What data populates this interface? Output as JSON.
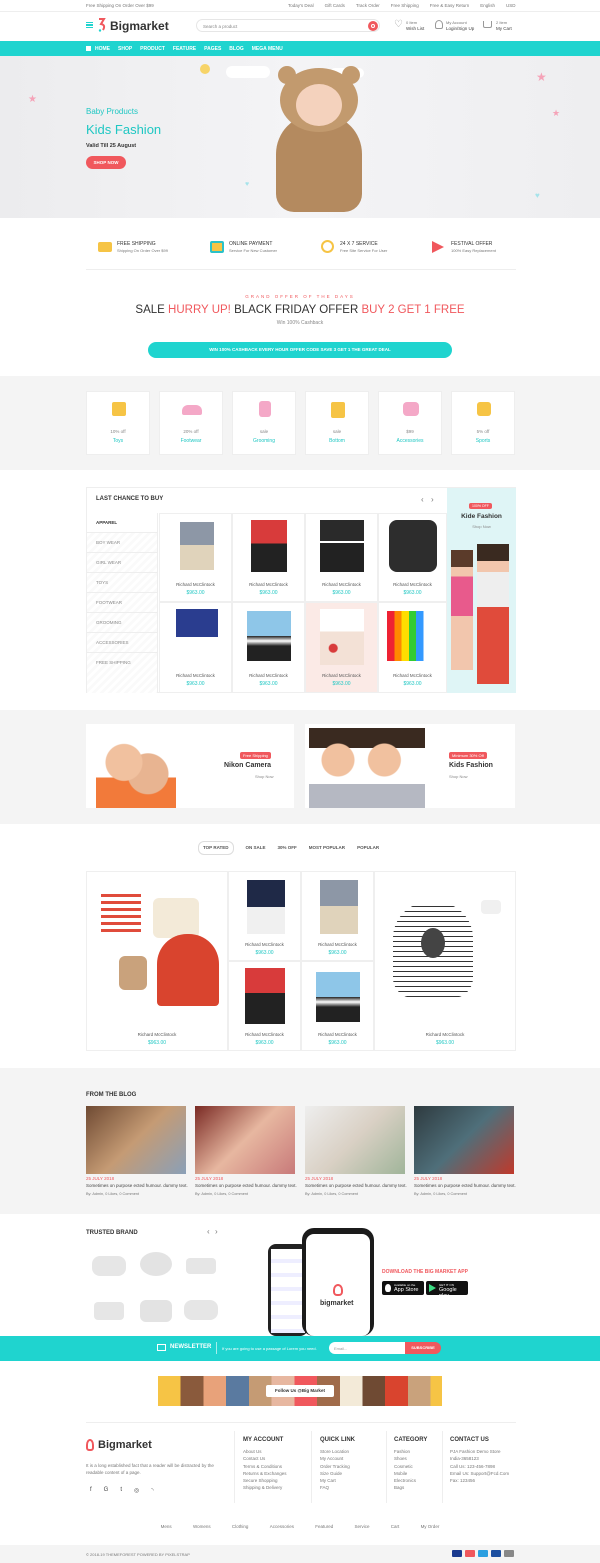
{
  "topbar": {
    "promo": "Free Shipping On Order Over $99",
    "links": [
      "Today's Deal",
      "Gift Cards",
      "Track Order",
      "Free Shipping",
      "Free & Easy Return",
      "English",
      "USD"
    ]
  },
  "header": {
    "logo": "Bigmarket",
    "search_placeholder": "Search a product",
    "wishlist_top": "0 Item",
    "wishlist": "Wish List",
    "account_top": "My Account",
    "account": "Login/Sign Up",
    "cart_top": "2 Item",
    "cart": "My Cart"
  },
  "nav": [
    "HOME",
    "SHOP",
    "PRODUCT",
    "FEATURE",
    "PAGES",
    "BLOG",
    "MEGA MENU"
  ],
  "hero": {
    "subtitle": "Baby Products",
    "title": "Kids Fashion",
    "valid": "Valid Till 25 August",
    "cta": "SHOP NOW"
  },
  "services": [
    {
      "title": "FREE SHIPPING",
      "sub": "Shipping On Order Over $99",
      "icon": "truck-icon"
    },
    {
      "title": "ONLINE PAYMENT",
      "sub": "Service For New Customer",
      "icon": "card-icon"
    },
    {
      "title": "24 X 7 SERVICE",
      "sub": "Free Site Service For User",
      "icon": "clock-icon"
    },
    {
      "title": "FESTIVAL OFFER",
      "sub": "100% Easy Replacement",
      "icon": "megaphone-icon"
    }
  ],
  "offer": {
    "kicker": "GRAND OFFER OF THE DAYS",
    "p1": "SALE ",
    "p2": "HURRY UP!",
    "p3": " BLACK FRIDAY OFFER ",
    "p4": "BUY 2 GET 1 FREE",
    "sub": "Win 100% Cashback",
    "bar": "WIN 100% CASHBACK EVERY HOUR OFFER CODE SAVE 3 GET 1 THE GREAT DEAL"
  },
  "categories": [
    {
      "off": "10% off",
      "name": "Toys"
    },
    {
      "off": "20% off",
      "name": "Footwear"
    },
    {
      "off": "sale",
      "name": "Grooming"
    },
    {
      "off": "sale",
      "name": "Bottom"
    },
    {
      "off": "$99",
      "name": "Accessories"
    },
    {
      "off": "5% off",
      "name": "Sports"
    }
  ],
  "last_chance": {
    "title": "LAST CHANCE TO BUY",
    "menu": [
      "APPAREL",
      "BOY WEAR",
      "GIRL WEAR",
      "TOYS",
      "FOOTWEAR",
      "GROOMING",
      "ACCESSORIES",
      "FREE SHIPPING"
    ],
    "product_name": "Richard McClintock",
    "product_price": "$963.00",
    "side_badge": "100% OFF",
    "side_title": "Kide Fashion",
    "side_link": "Shop Now"
  },
  "promos": [
    {
      "badge": "Free Shipping",
      "title": "Nikon Camera",
      "link": "Shop Now"
    },
    {
      "badge": "Minimum 30% Off",
      "title": "Kids Fashion",
      "link": "Shop Now"
    }
  ],
  "tabs": [
    "TOP RATED",
    "ON SALE",
    "30% OFF",
    "MOST POPULAR",
    "POPULAR"
  ],
  "grid_product": {
    "name": "Richard McClintock",
    "price": "$963.00"
  },
  "blog": {
    "title": "FROM THE BLOG",
    "date": "25 JULY 2018",
    "excerpt": "Sometimes on purpose ected humour. dummy text.",
    "meta": "By: Admin, 0 Likes, 0 Comment"
  },
  "brands": {
    "title": "TRUSTED BRAND"
  },
  "app": {
    "title": "DOWNLOAD THE BIG MARKET APP",
    "store1_top": "Available on the",
    "store1": "App Store",
    "store2_top": "GET IT ON",
    "store2": "Google play",
    "phone_logo": "bigmarket"
  },
  "newsletter": {
    "title": "NEWSLETTER",
    "text": "If you are going to use a passage of Lorem you need.",
    "placeholder": "Email...",
    "button": "SUBSCRIBE"
  },
  "instagram": {
    "label": "Follow Us @Big Market"
  },
  "footer": {
    "logo": "Bigmarket",
    "about": "It is a long established fact that a reader will be distracted by the readable content of a page.",
    "my_account": {
      "title": "MY ACCOUNT",
      "items": [
        "About Us",
        "Contact Us",
        "Terms & Conditions",
        "Returns & Exchanges",
        "Secure Shopping",
        "Shipping & Delivery"
      ]
    },
    "quick_link": {
      "title": "QUICK LINK",
      "items": [
        "Store Location",
        "My Account",
        "Order Tracking",
        "Size Guide",
        "My Cart",
        "FAQ"
      ]
    },
    "category": {
      "title": "CATEGORY",
      "items": [
        "Fashion",
        "Shoes",
        "Cosmetic",
        "Mobile",
        "Electronics",
        "Bags"
      ]
    },
    "contact": {
      "title": "CONTACT US",
      "items": [
        "PJA Fashion Demo Store",
        "India-3658123",
        "Call Us: 123-456-7898",
        "Email Us: Support@Fcd.Com",
        "Fax: 123456"
      ]
    }
  },
  "bottom_links": [
    "Mens",
    "Womens",
    "Clothing",
    "Accessories",
    "Featured",
    "Service",
    "Cart",
    "My Order"
  ],
  "copyright": "© 2018-19 THEMEFOREST POWERED BY PIXELSTRAP",
  "colors": {
    "teal": "#1fd4cf",
    "coral": "#f0585d",
    "dark": "#333333"
  }
}
